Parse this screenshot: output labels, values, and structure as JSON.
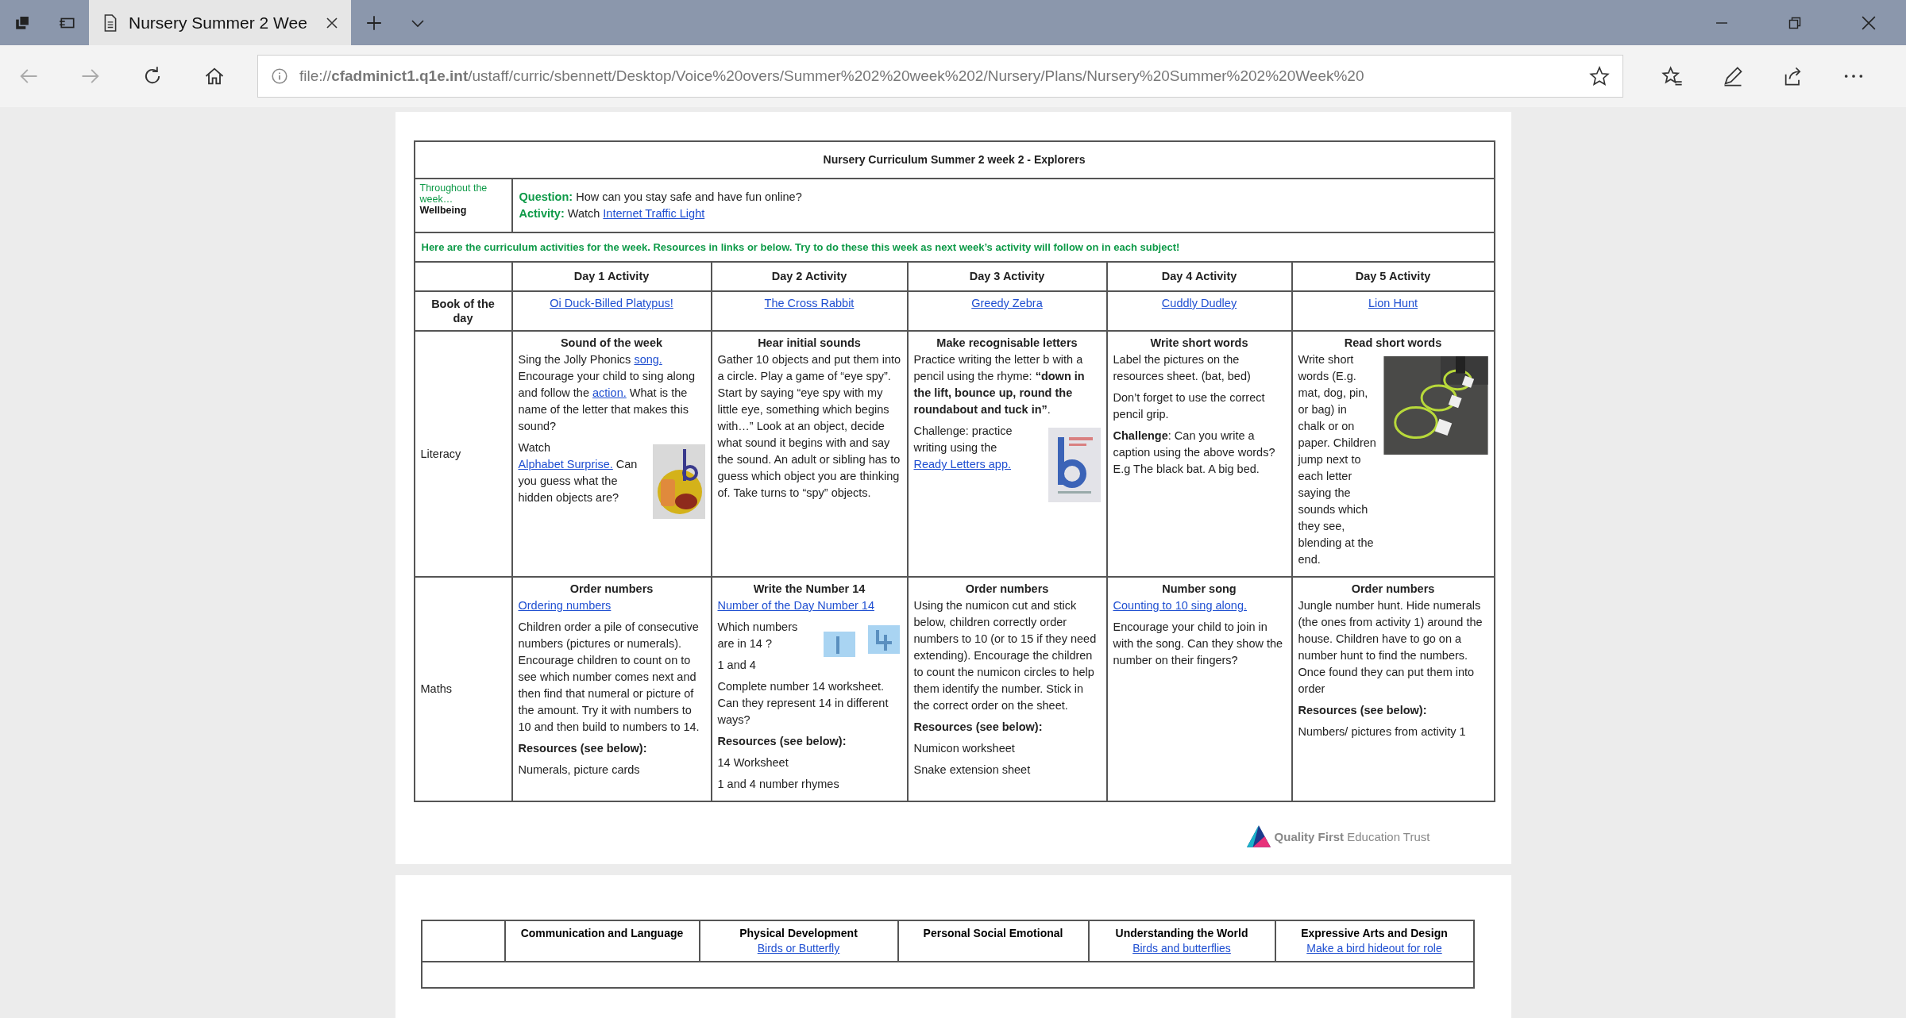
{
  "browser": {
    "tabs": [
      {
        "title": "Nursery Summer 2 Wee",
        "selected": true
      }
    ],
    "url": "file://**cfadminict1.q1e.int**/ustaff/curric/sbennett/Desktop/Voice%20overs/Summer%202%20week%202/Nursery/Plans/Nursery%20Summer%202%20Week%20"
  },
  "document": {
    "title": "Nursery Curriculum Summer 2 week 2 - Explorers",
    "wellbeing": {
      "label": "Throughout the week…",
      "sublabel": "Wellbeing",
      "question_label": "Question:",
      "question": " How can you stay safe and have fun online?",
      "activity_label": "Activity:",
      "activity_text": " Watch ",
      "activity_link": "Internet Traffic Light"
    },
    "notice": "Here are the curriculum activities for the week.  Resources in links or below. Try to do these this week as next week’s activity will follow on in each subject!",
    "columns": [
      "Day 1 Activity",
      "Day 2 Activity",
      "Day 3 Activity",
      "Day 4 Activity",
      "Day 5 Activity"
    ],
    "rows": [
      {
        "label": "Book of the day",
        "kind": "book",
        "cells": [
          {
            "blocks": [
              {
                "kind": "text",
                "parts": [
                  {
                    "kind": "link",
                    "text": "Oi Duck-Billed Platypus!"
                  }
                ]
              }
            ]
          },
          {
            "blocks": [
              {
                "kind": "text",
                "parts": [
                  {
                    "kind": "link",
                    "text": "The Cross Rabbit"
                  }
                ]
              }
            ]
          },
          {
            "blocks": [
              {
                "kind": "text",
                "parts": [
                  {
                    "kind": "link",
                    "text": "Greedy Zebra"
                  }
                ]
              }
            ]
          },
          {
            "blocks": [
              {
                "kind": "text",
                "parts": [
                  {
                    "kind": "link",
                    "text": "Cuddly Dudley"
                  }
                ]
              }
            ]
          },
          {
            "blocks": [
              {
                "kind": "text",
                "parts": [
                  {
                    "kind": "link",
                    "text": "Lion Hunt"
                  }
                ]
              }
            ]
          }
        ]
      },
      {
        "label": "Literacy",
        "kind": "activity",
        "cells": [
          {
            "heading": "Sound of the week",
            "blocks": [
              {
                "kind": "text",
                "parts": [
                  {
                    "kind": "text",
                    "text": "Sing the Jolly Phonics "
                  },
                  {
                    "kind": "link",
                    "text": "song."
                  },
                  {
                    "kind": "text",
                    "text": " Encourage your child to sing along and follow the "
                  },
                  {
                    "kind": "link",
                    "text": "action."
                  },
                  {
                    "kind": "text",
                    "text": " What is the name of the letter that makes this sound?"
                  }
                ]
              },
              {
                "kind": "picture"
              },
              {
                "kind": "text",
                "parts": [
                  {
                    "kind": "text",
                    "text": "Watch "
                  },
                  {
                    "kind": "link",
                    "text": "Alphabet Surprise."
                  },
                  {
                    "kind": "text",
                    "text": " Can you guess what the hidden objects are?"
                  }
                ]
              }
            ]
          },
          {
            "heading": "Hear initial sounds",
            "blocks": [
              {
                "kind": "text",
                "parts": [
                  {
                    "kind": "text",
                    "text": "Gather 10 objects and put them into a circle. Play a game of “eye spy”. Start by saying “eye spy with my little eye, something which begins with…” Look at an object, decide what sound it begins with and say the sound. An adult or sibling has to guess which object you are thinking of. Take turns to “spy” objects."
                  }
                ]
              }
            ]
          },
          {
            "heading": "Make recognisable letters",
            "blocks": [
              {
                "kind": "text",
                "parts": [
                  {
                    "kind": "text",
                    "text": "Practice writing the letter b with a pencil using the rhyme: **“down in the lift, bounce up, round the roundabout and tuck in”**."
                  }
                ]
              },
              {
                "kind": "picture"
              },
              {
                "kind": "text",
                "parts": [
                  {
                    "kind": "text",
                    "text": "Challenge: practice writing using the "
                  },
                  {
                    "kind": "link",
                    "text": "Ready Letters app."
                  }
                ]
              }
            ]
          },
          {
            "heading": "Write short words",
            "blocks": [
              {
                "kind": "text",
                "parts": [
                  {
                    "kind": "text",
                    "text": "Label the pictures on the resources sheet. (bat, bed)"
                  }
                ]
              },
              {
                "kind": "text",
                "parts": [
                  {
                    "kind": "text",
                    "text": "Don’t forget to use the correct pencil grip."
                  }
                ]
              },
              {
                "kind": "text",
                "parts": [
                  {
                    "kind": "text",
                    "text": "**Challenge**: Can you write a caption using the above words? E.g The black bat. A big bed."
                  }
                ]
              }
            ]
          },
          {
            "heading": "Read short words",
            "blocks": [
              {
                "kind": "picture"
              },
              {
                "kind": "text",
                "parts": [
                  {
                    "kind": "text",
                    "text": "Write short words (E.g. mat, dog, pin, or bag) in chalk or on paper. Children jump next to each letter saying the sounds which they see, blending at the end."
                  }
                ]
              }
            ]
          }
        ]
      },
      {
        "label": "Maths",
        "kind": "activity",
        "cells": [
          {
            "heading": "Order numbers",
            "blocks": [
              {
                "kind": "text",
                "parts": [
                  {
                    "kind": "link",
                    "text": "Ordering numbers"
                  }
                ]
              },
              {
                "kind": "text",
                "parts": [
                  {
                    "kind": "text",
                    "text": "Children order a pile of consecutive numbers (pictures or numerals). Encourage children to count on to see which number comes next and then find that numeral or picture of the amount. Try it with numbers to 10 and then build to numbers to 14."
                  }
                ]
              },
              {
                "kind": "text",
                "parts": [
                  {
                    "kind": "text",
                    "text": "**Resources (see below):**"
                  }
                ]
              },
              {
                "kind": "text",
                "parts": [
                  {
                    "kind": "text",
                    "text": "Numerals, picture cards"
                  }
                ]
              }
            ]
          },
          {
            "heading": "Write the Number 14",
            "blocks": [
              {
                "kind": "text",
                "parts": [
                  {
                    "kind": "link",
                    "text": "Number of the Day Number 14"
                  }
                ]
              },
              {
                "kind": "picture"
              },
              {
                "kind": "text",
                "parts": [
                  {
                    "kind": "text",
                    "text": "Which numbers are in 14 ?"
                  }
                ]
              },
              {
                "kind": "text",
                "parts": [
                  {
                    "kind": "text",
                    "text": "1 and 4"
                  }
                ]
              },
              {
                "kind": "text",
                "parts": [
                  {
                    "kind": "text",
                    "text": "Complete number 14 worksheet.  Can they represent 14 in different ways?"
                  }
                ]
              },
              {
                "kind": "text",
                "parts": [
                  {
                    "kind": "text",
                    "text": "**Resources (see below):**"
                  }
                ]
              },
              {
                "kind": "text",
                "parts": [
                  {
                    "kind": "text",
                    "text": "14 Worksheet"
                  }
                ]
              },
              {
                "kind": "text",
                "parts": [
                  {
                    "kind": "text",
                    "text": "1 and 4 number rhymes"
                  }
                ]
              }
            ]
          },
          {
            "heading": "Order numbers",
            "blocks": [
              {
                "kind": "text",
                "parts": [
                  {
                    "kind": "text",
                    "text": "Using the numicon cut and stick below, children correctly order numbers to 10 (or to 15 if they need extending). Encourage the children to count the numicon circles to help them identify the number. Stick in the correct order on the sheet."
                  }
                ]
              },
              {
                "kind": "text",
                "parts": [
                  {
                    "kind": "text",
                    "text": "**Resources (see below):**"
                  }
                ]
              },
              {
                "kind": "text",
                "parts": [
                  {
                    "kind": "text",
                    "text": "Numicon worksheet"
                  }
                ]
              },
              {
                "kind": "text",
                "parts": [
                  {
                    "kind": "text",
                    "text": "Snake extension sheet"
                  }
                ]
              }
            ]
          },
          {
            "heading": "Number song",
            "blocks": [
              {
                "kind": "text",
                "parts": [
                  {
                    "kind": "link",
                    "text": "Counting to 10 sing along."
                  }
                ]
              },
              {
                "kind": "text",
                "parts": [
                  {
                    "kind": "text",
                    "text": "Encourage your child to join in with the song.  Can they show the number on their fingers?"
                  }
                ]
              }
            ]
          },
          {
            "heading": "Order numbers",
            "blocks": [
              {
                "kind": "text",
                "parts": [
                  {
                    "kind": "text",
                    "text": "Jungle number hunt. Hide numerals (the ones from activity 1) around the house. Children have to go on a number hunt to find the numbers.  Once found they can put them into order"
                  }
                ]
              },
              {
                "kind": "text",
                "parts": [
                  {
                    "kind": "text",
                    "text": "**Resources (see below):**"
                  }
                ]
              },
              {
                "kind": "text",
                "parts": [
                  {
                    "kind": "text",
                    "text": "Numbers/ pictures from activity 1"
                  }
                ]
              }
            ]
          }
        ]
      }
    ],
    "footer_logo": "**Quality First** Education Trust"
  },
  "next_page": {
    "columns": [
      {
        "heading": "Communication and Language"
      },
      {
        "heading": "Physical Development",
        "link": "Birds or Butterfly"
      },
      {
        "heading": "Personal Social Emotional"
      },
      {
        "heading": "Understanding the World",
        "link": "Birds and butterflies"
      },
      {
        "heading": "Expressive Arts and Design",
        "link": "Make a bird hideout for role"
      }
    ]
  }
}
